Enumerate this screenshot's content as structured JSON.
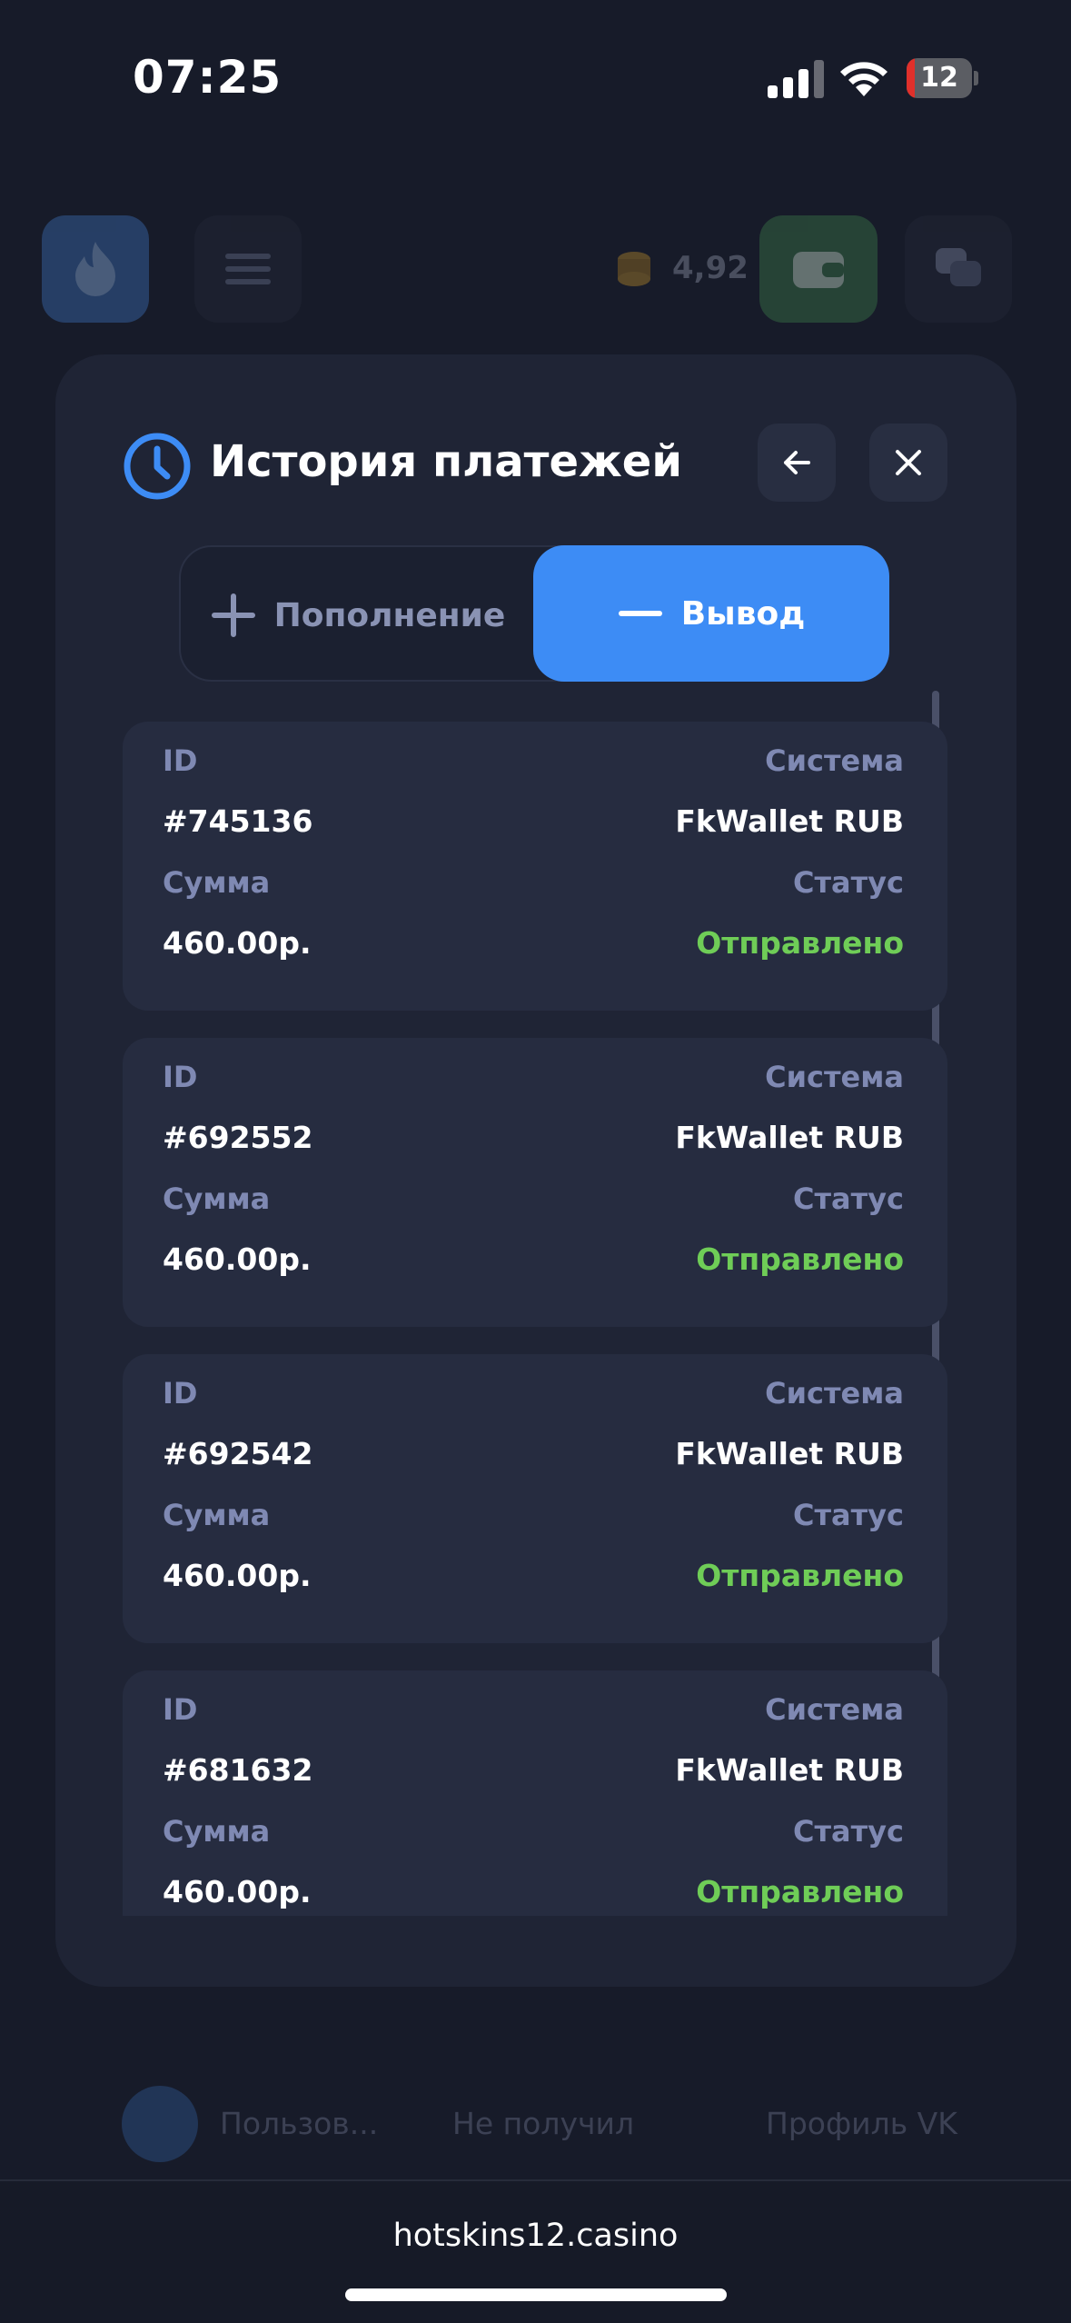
{
  "status_bar": {
    "time": "07:25",
    "battery_level": "12",
    "battery_color": "#e0302b"
  },
  "background": {
    "balance": "4,92",
    "row": {
      "user": "Пользов...",
      "status": "Не получил",
      "profile": "Профиль VK"
    }
  },
  "modal": {
    "title": "История платежей",
    "icons": {
      "title": "clock-icon",
      "back": "arrow-left-icon",
      "close": "close-icon"
    },
    "tabs": [
      {
        "label": "Пополнение",
        "icon": "plus-icon",
        "active": false
      },
      {
        "label": "Вывод",
        "icon": "minus-icon",
        "active": true
      }
    ],
    "accent_color": "#3d8cf5",
    "success_color": "#6fcd57",
    "labels": {
      "id": "ID",
      "system": "Система",
      "amount": "Сумма",
      "status": "Статус"
    },
    "payments": [
      {
        "id": "#745136",
        "system": "FkWallet RUB",
        "amount": "460.00р.",
        "status": "Отправлено"
      },
      {
        "id": "#692552",
        "system": "FkWallet RUB",
        "amount": "460.00р.",
        "status": "Отправлено"
      },
      {
        "id": "#692542",
        "system": "FkWallet RUB",
        "amount": "460.00р.",
        "status": "Отправлено"
      },
      {
        "id": "#681632",
        "system": "FkWallet RUB",
        "amount": "460.00р.",
        "status": "Отправлено"
      }
    ]
  },
  "browser": {
    "url": "hotskins12.casino"
  }
}
